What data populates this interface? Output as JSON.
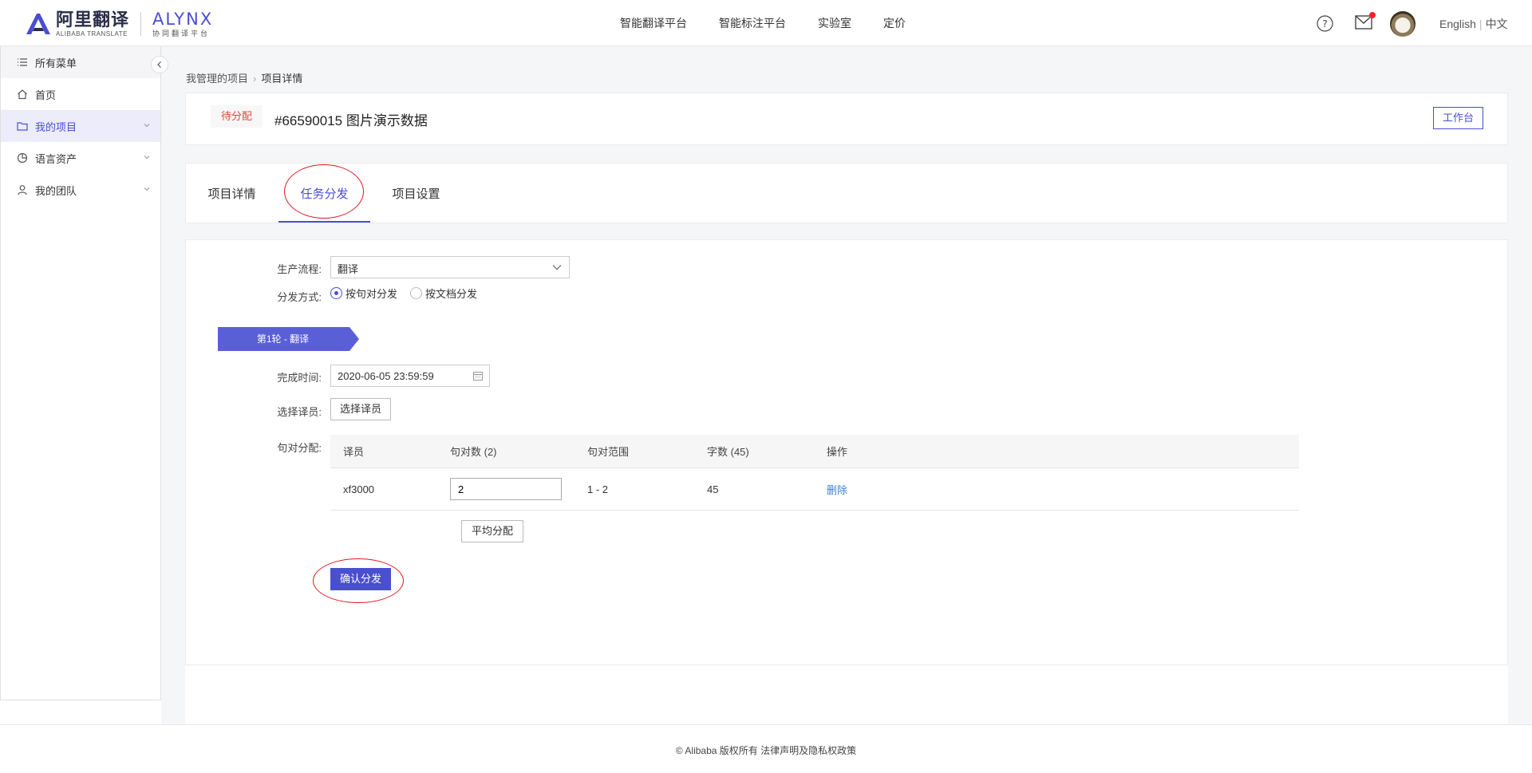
{
  "header": {
    "logo_cn": "阿里翻译",
    "logo_cn_sub": "ALIBABA TRANSLATE",
    "logo_en": "ALYNX",
    "logo_en_sub": "协同翻译平台",
    "nav": [
      "智能翻译平台",
      "智能标注平台",
      "实验室",
      "定价"
    ],
    "lang_en": "English",
    "lang_sep": "|",
    "lang_cn": "中文",
    "help_icon": "help-circle-icon",
    "mail_icon": "mail-icon",
    "mail_badge_color": "#f5222d"
  },
  "sidebar": {
    "items": [
      {
        "label": "所有菜单",
        "icon": "list-icon"
      },
      {
        "label": "首页",
        "icon": "home-icon"
      },
      {
        "label": "我的项目",
        "icon": "folder-icon"
      },
      {
        "label": "语言资产",
        "icon": "pie-chart-icon"
      },
      {
        "label": "我的团队",
        "icon": "user-icon"
      }
    ]
  },
  "breadcrumb": {
    "parent": "我管理的项目",
    "arrow": "›",
    "current": "项目详情"
  },
  "project": {
    "status": "待分配",
    "title": "#66590015 图片演示数据",
    "workbench_label": "工作台"
  },
  "tabs": [
    "项目详情",
    "任务分发",
    "项目设置"
  ],
  "form": {
    "workflow_label": "生产流程:",
    "workflow_value": "翻译",
    "method_label": "分发方式:",
    "method_options": [
      "按句对分发",
      "按文档分发"
    ],
    "round_label": "第1轮 - 翻译",
    "deadline_label": "完成时间:",
    "deadline_value": "2020-06-05 23:59:59",
    "translator_label": "选择译员:",
    "translator_button": "选择译员",
    "allocation_label": "句对分配:",
    "table_headers": [
      "译员",
      "句对数 (2)",
      "句对范围",
      "字数 (45)",
      "操作"
    ],
    "rows": [
      {
        "translator": "xf3000",
        "count": "2",
        "range": "1 - 2",
        "words": "45",
        "action": "删除"
      }
    ],
    "average_button": "平均分配",
    "confirm_button": "确认分发"
  },
  "footer": {
    "text": "© Alibaba 版权所有 法律声明及隐私权政策"
  },
  "colors": {
    "accent": "#4a4fd1",
    "status_red": "#e8453c",
    "annotation_red": "#e0161f",
    "link_blue": "#3d7fd6"
  }
}
